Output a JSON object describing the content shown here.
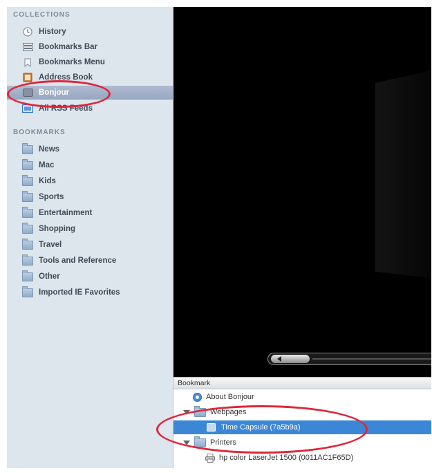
{
  "sidebar": {
    "collections_header": "COLLECTIONS",
    "collections": [
      {
        "label": "History",
        "icon": "clock-icon"
      },
      {
        "label": "Bookmarks Bar",
        "icon": "bookmarks-bar-icon"
      },
      {
        "label": "Bookmarks Menu",
        "icon": "bookmarks-menu-icon"
      },
      {
        "label": "Address Book",
        "icon": "address-book-icon"
      },
      {
        "label": "Bonjour",
        "icon": "bonjour-icon"
      },
      {
        "label": "All RSS Feeds",
        "icon": "rss-icon"
      }
    ],
    "bookmarks_header": "BOOKMARKS",
    "bookmarks": [
      {
        "label": "News"
      },
      {
        "label": "Mac"
      },
      {
        "label": "Kids"
      },
      {
        "label": "Sports"
      },
      {
        "label": "Entertainment"
      },
      {
        "label": "Shopping"
      },
      {
        "label": "Travel"
      },
      {
        "label": "Tools and Reference"
      },
      {
        "label": "Other"
      },
      {
        "label": "Imported IE Favorites"
      }
    ]
  },
  "bookmark_list": {
    "header": "Bookmark",
    "rows": [
      {
        "label": "About Bonjour",
        "icon": "bonjour-icon"
      },
      {
        "label": "Webpages",
        "icon": "folder-icon"
      },
      {
        "label": "Time Capsule (7a5b9a)",
        "icon": "bookmark-icon"
      },
      {
        "label": "Printers",
        "icon": "folder-icon"
      },
      {
        "label": "hp color LaserJet 1500 (0011AC1F65D)",
        "icon": "printer-icon"
      }
    ]
  },
  "colors": {
    "annotation": "#e0263a",
    "selection": "#3b87d6",
    "sidebar_selection": "#96a7c1"
  }
}
